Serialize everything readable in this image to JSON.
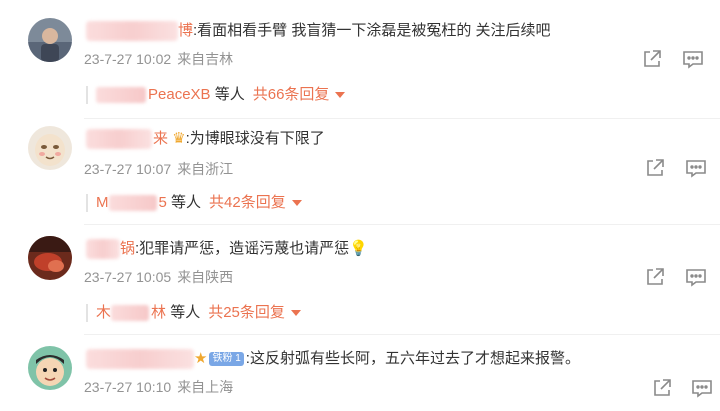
{
  "comments": [
    {
      "name_suffix": "博",
      "text": ":看面相看手臂  我盲猜一下涂磊是被冤枉的 关注后续吧",
      "date": "23-7-27 10:02",
      "location": "来自吉林",
      "reply_user": "PeaceXB",
      "reply_others": "等人",
      "reply_count": "共66条回复"
    },
    {
      "name_suffix": "来",
      "text": ":为博眼球没有下限了",
      "date": "23-7-27 10:07",
      "location": "来自浙江",
      "reply_user_prefix": "M",
      "reply_user_suffix": "5",
      "reply_others": "等人",
      "reply_count": "共42条回复"
    },
    {
      "name_suffix": "锅",
      "text": ":犯罪请严惩，造谣污蔑也请严惩",
      "date": "23-7-27 10:05",
      "location": "来自陕西",
      "reply_user_prefix": "木",
      "reply_user_suffix": "林",
      "reply_others": "等人",
      "reply_count": "共25条回复"
    },
    {
      "badge": "铁粉 1",
      "text": ":这反射弧有些长阿，五六年过去了才想起来报警。",
      "date": "23-7-27 10:10",
      "location": "来自上海"
    }
  ],
  "icons": {
    "share": "share-icon",
    "comment": "comment-icon"
  },
  "colors": {
    "accent": "#eb7350",
    "meta": "#939393",
    "badge": "#7aa7e6"
  }
}
